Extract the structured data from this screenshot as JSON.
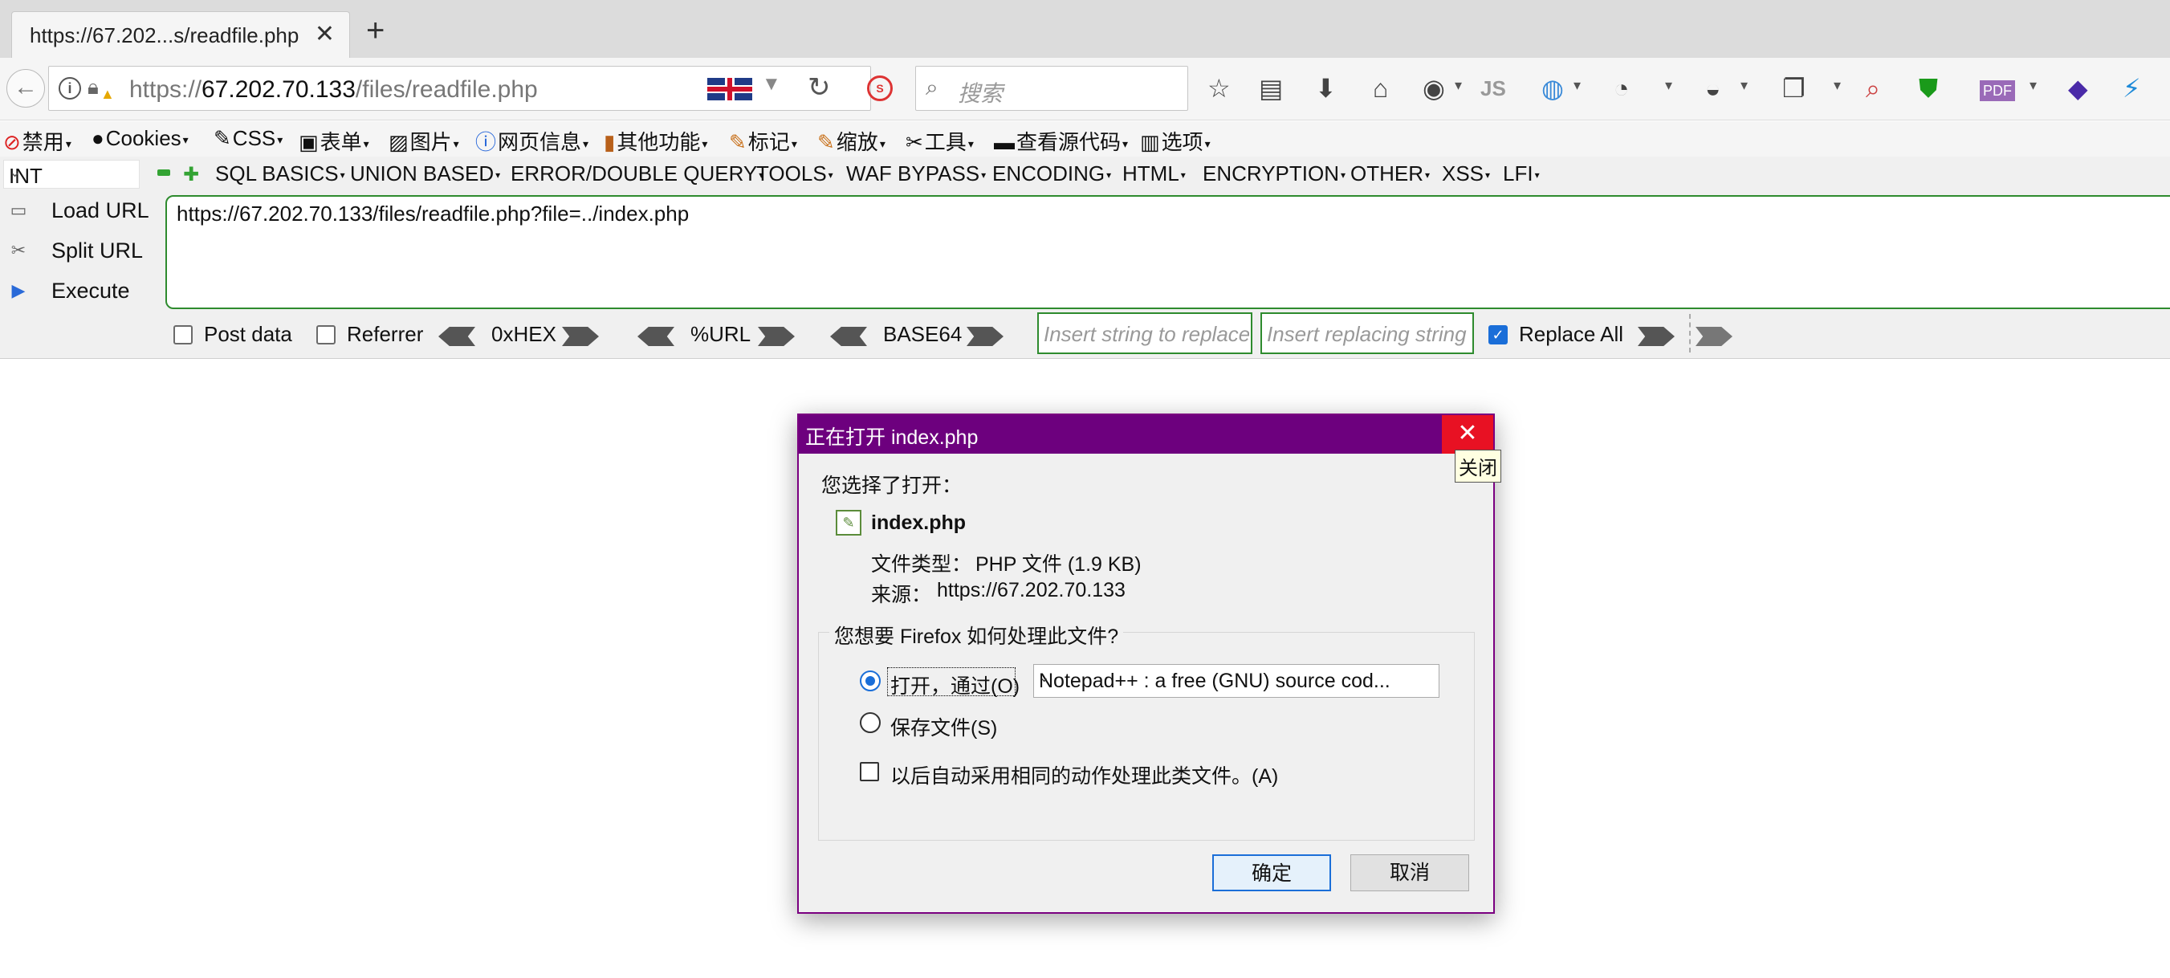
{
  "tab": {
    "title": "https://67.202...s/readfile.php",
    "close": "✕",
    "new_tab": "+"
  },
  "navbar": {
    "back": "←",
    "url_prefix": "https://",
    "url_host": "67.202.70.133",
    "url_path": "/files/readfile.php",
    "search_placeholder": "搜索",
    "js_label": "JS",
    "pdf_label": "PDF"
  },
  "menubar": {
    "items": [
      "禁用",
      "Cookies",
      "CSS",
      "表单",
      "图片",
      "网页信息",
      "其他功能",
      "标记",
      "缩放",
      "工具",
      "查看源代码",
      "选项"
    ]
  },
  "hackbar": {
    "type_select": "INT",
    "menus": [
      "SQL BASICS",
      "UNION BASED",
      "ERROR/DOUBLE QUERY",
      "TOOLS",
      "WAF BYPASS",
      "ENCODING",
      "HTML",
      "ENCRYPTION",
      "OTHER",
      "XSS",
      "LFI"
    ],
    "load_url": "Load URL",
    "split_url": "Split URL",
    "execute": "Execute",
    "url_value": "https://67.202.70.133/files/readfile.php?file=../index.php",
    "post_data": "Post data",
    "post_data_checked": false,
    "referrer": "Referrer",
    "referrer_checked": false,
    "hex": "0xHEX",
    "url_enc": "%URL",
    "base64": "BASE64",
    "insert_placeholder": "Insert string to replace",
    "replacing_placeholder": "Insert replacing string",
    "replace_all": "Replace All",
    "replace_all_checked": true
  },
  "dialog": {
    "title": "正在打开 index.php",
    "close_tooltip": "关闭",
    "chosen_label": "您选择了打开：",
    "file_name": "index.php",
    "file_type_label": "文件类型：",
    "file_type_value": "PHP 文件 (1.9 KB)",
    "source_label": "来源：",
    "source_value": "https://67.202.70.133",
    "question": "您想要 Firefox 如何处理此文件?",
    "open_with_label": "打开，通过(O)",
    "open_with_app": "Notepad++ : a free (GNU) source cod...",
    "save_file_label": "保存文件(S)",
    "remember_label": "以后自动采用相同的动作处理此类文件。(A)",
    "ok": "确定",
    "cancel": "取消",
    "selected_action": "open"
  },
  "colors": {
    "dialog_title_bg": "#6d007e",
    "close_red": "#e81123",
    "hackbar_green": "#2e8b2e",
    "accent_blue": "#1a6ed8"
  }
}
